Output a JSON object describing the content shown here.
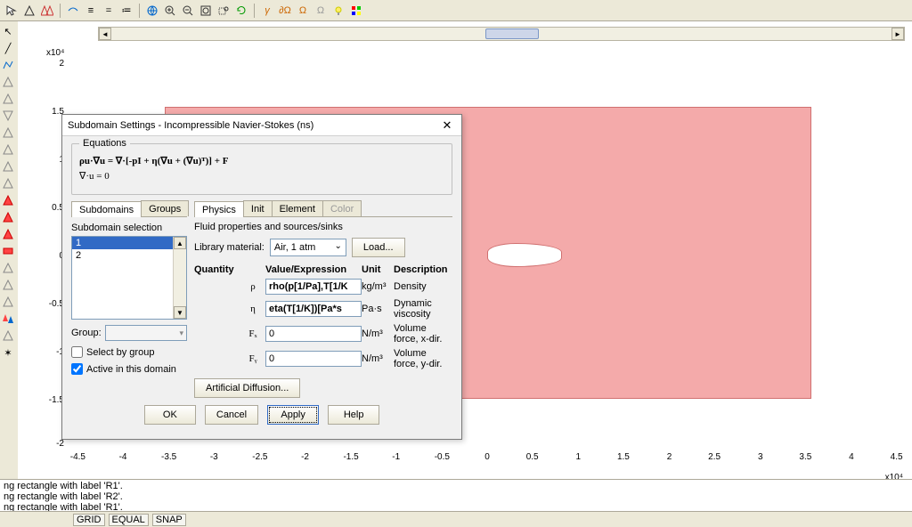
{
  "axes": {
    "y_exp": "x10⁴",
    "x_exp": "x10⁴",
    "y_ticks": [
      "2",
      "1.5",
      "1",
      "0.5",
      "0",
      "-0.5",
      "-1",
      "-1.5",
      "-2"
    ],
    "x_ticks": [
      "-4.5",
      "-4",
      "-3.5",
      "-3",
      "-2.5",
      "-2",
      "-1.5",
      "-1",
      "-0.5",
      "0",
      "0.5",
      "1",
      "1.5",
      "2",
      "2.5",
      "3",
      "3.5",
      "4",
      "4.5"
    ]
  },
  "log": {
    "line1": "ng rectangle with label 'R1'.",
    "line2": "ng rectangle with label 'R2'.",
    "line3": "ng rectangle with label 'R1'."
  },
  "status": {
    "grid": "GRID",
    "equal": "EQUAL",
    "snap": "SNAP"
  },
  "dialog": {
    "title": "Subdomain Settings - Incompressible Navier-Stokes (ns)",
    "equations_legend": "Equations",
    "eq1": "ρu·∇u = ∇·[-pI + η(∇u + (∇u)ᵀ)] + F",
    "eq2": "∇·u = 0",
    "left_tabs": {
      "subdomains": "Subdomains",
      "groups": "Groups"
    },
    "subdomain_selection_label": "Subdomain selection",
    "subdomain_items": {
      "one": "1",
      "two": "2"
    },
    "group_label": "Group:",
    "select_by_group": "Select by group",
    "active_in_domain": "Active in this domain",
    "right_tabs": {
      "physics": "Physics",
      "init": "Init",
      "element": "Element",
      "color": "Color"
    },
    "fluid_props_header": "Fluid properties and sources/sinks",
    "library_material_label": "Library material:",
    "library_material_value": "Air, 1 atm",
    "load_btn": "Load...",
    "grid_headers": {
      "quantity": "Quantity",
      "value": "Value/Expression",
      "unit": "Unit",
      "desc": "Description"
    },
    "rows": {
      "rho": {
        "sym": "ρ",
        "val": "rho(p[1/Pa],T[1/K",
        "unit": "kg/m³",
        "desc": "Density"
      },
      "eta": {
        "sym": "η",
        "val": "eta(T[1/K])[Pa*s",
        "unit": "Pa·s",
        "desc": "Dynamic viscosity"
      },
      "fx": {
        "sym": "Fₓ",
        "val": "0",
        "unit": "N/m³",
        "desc": "Volume force, x-dir."
      },
      "fy": {
        "sym": "Fᵧ",
        "val": "0",
        "unit": "N/m³",
        "desc": "Volume force, y-dir."
      }
    },
    "artificial_diffusion": "Artificial Diffusion...",
    "buttons": {
      "ok": "OK",
      "cancel": "Cancel",
      "apply": "Apply",
      "help": "Help"
    }
  }
}
